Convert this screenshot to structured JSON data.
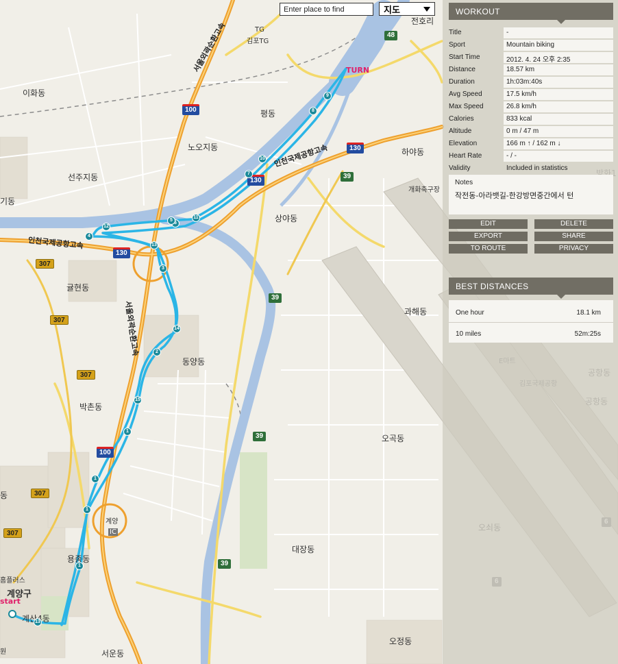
{
  "map": {
    "search_placeholder": "Enter place to find",
    "map_type": "지도",
    "labels": {
      "ihwa": "이화동",
      "pyeong": "평동",
      "noji": "노오지동",
      "seonju": "선주지동",
      "haya": "하야동",
      "gaehwa": "개화축구장",
      "sangya": "상야동",
      "gyul": "귤현동",
      "dongyang": "동양동",
      "bakchon": "박촌동",
      "gwahae": "과해동",
      "ogok": "오곡동",
      "oswae": "오쇠동",
      "yongjong": "용종동",
      "daejang": "대장동",
      "gyeyang": "계양구",
      "gyesan": "계산4동",
      "seoun": "서운동",
      "ojeong": "오정동",
      "gimpo_tg": "김포TG",
      "tg": "TG",
      "jeonho": "전호리",
      "gimpo_airport": "김포국제공항",
      "emart": "E마트",
      "gonghang1": "공항동",
      "gonghang2": "공항동",
      "banghwa": "방화1",
      "gyeyang_ic": "계양",
      "ic": "IC",
      "hw_seoul_ring": "서울외곽순환고속",
      "hw_seoul_ring2": "서울외곽순환고속",
      "hw_incheon_airport": "인천국제공항고속",
      "hw_incheon_airport2": "인천국제공항고속",
      "turn": "TURN",
      "start": "start",
      "left_dong1": "기동",
      "left_dong2": "동",
      "plus": "홈플러스",
      "won": "원"
    },
    "shields": {
      "s100a": "100",
      "s100b": "100",
      "s130a": "130",
      "s130b": "130",
      "s130c": "130",
      "s39a": "39",
      "s39b": "39",
      "s39c": "39",
      "s39d": "39",
      "s307a": "307",
      "s307b": "307",
      "s307c": "307",
      "s307d": "307",
      "s307e": "307",
      "s48": "48",
      "s6a": "6",
      "s6b": "6"
    },
    "markers": [
      "1",
      "2",
      "3",
      "4",
      "6",
      "7",
      "8",
      "9",
      "10",
      "11",
      "12",
      "13",
      "14",
      "15",
      "1",
      "1",
      "5",
      "13",
      "1"
    ]
  },
  "workout": {
    "header": "WORKOUT",
    "fields": [
      {
        "label": "Title",
        "value": "-"
      },
      {
        "label": "Sport",
        "value": "Mountain biking"
      },
      {
        "label": "Start Time",
        "value": "2012. 4. 24 오후 2:35"
      },
      {
        "label": "Distance",
        "value": "18.57 km"
      },
      {
        "label": "Duration",
        "value": "1h:03m:40s"
      },
      {
        "label": "Avg Speed",
        "value": "17.5 km/h"
      },
      {
        "label": "Max Speed",
        "value": "26.8 km/h"
      },
      {
        "label": "Calories",
        "value": "833 kcal"
      },
      {
        "label": "Altitude",
        "value": "0 m / 47 m"
      },
      {
        "label": "Elevation",
        "value": "166 m ↑ / 162 m ↓"
      },
      {
        "label": "Heart Rate",
        "value": "- / -"
      },
      {
        "label": "Validity",
        "value": "Included in statistics"
      }
    ],
    "notes_title": "Notes",
    "notes_value": "작전동-아라뱃길-한강방면중간에서 턴",
    "buttons": {
      "edit": "EDIT",
      "delete": "DELETE",
      "export": "EXPORT",
      "share": "SHARE",
      "to_route": "TO ROUTE",
      "privacy": "PRIVACY"
    }
  },
  "best_distances": {
    "header": "BEST DISTANCES",
    "rows": [
      {
        "label": "One hour",
        "value": "18.1 km"
      },
      {
        "label": "10 miles",
        "value": "52m:25s"
      }
    ]
  },
  "colors": {
    "route": "#2bb5e6",
    "river": "#a9c3e3",
    "highway": "#f2a93a",
    "road_yellow": "#f4d96b",
    "panel_header": "#716e64"
  }
}
